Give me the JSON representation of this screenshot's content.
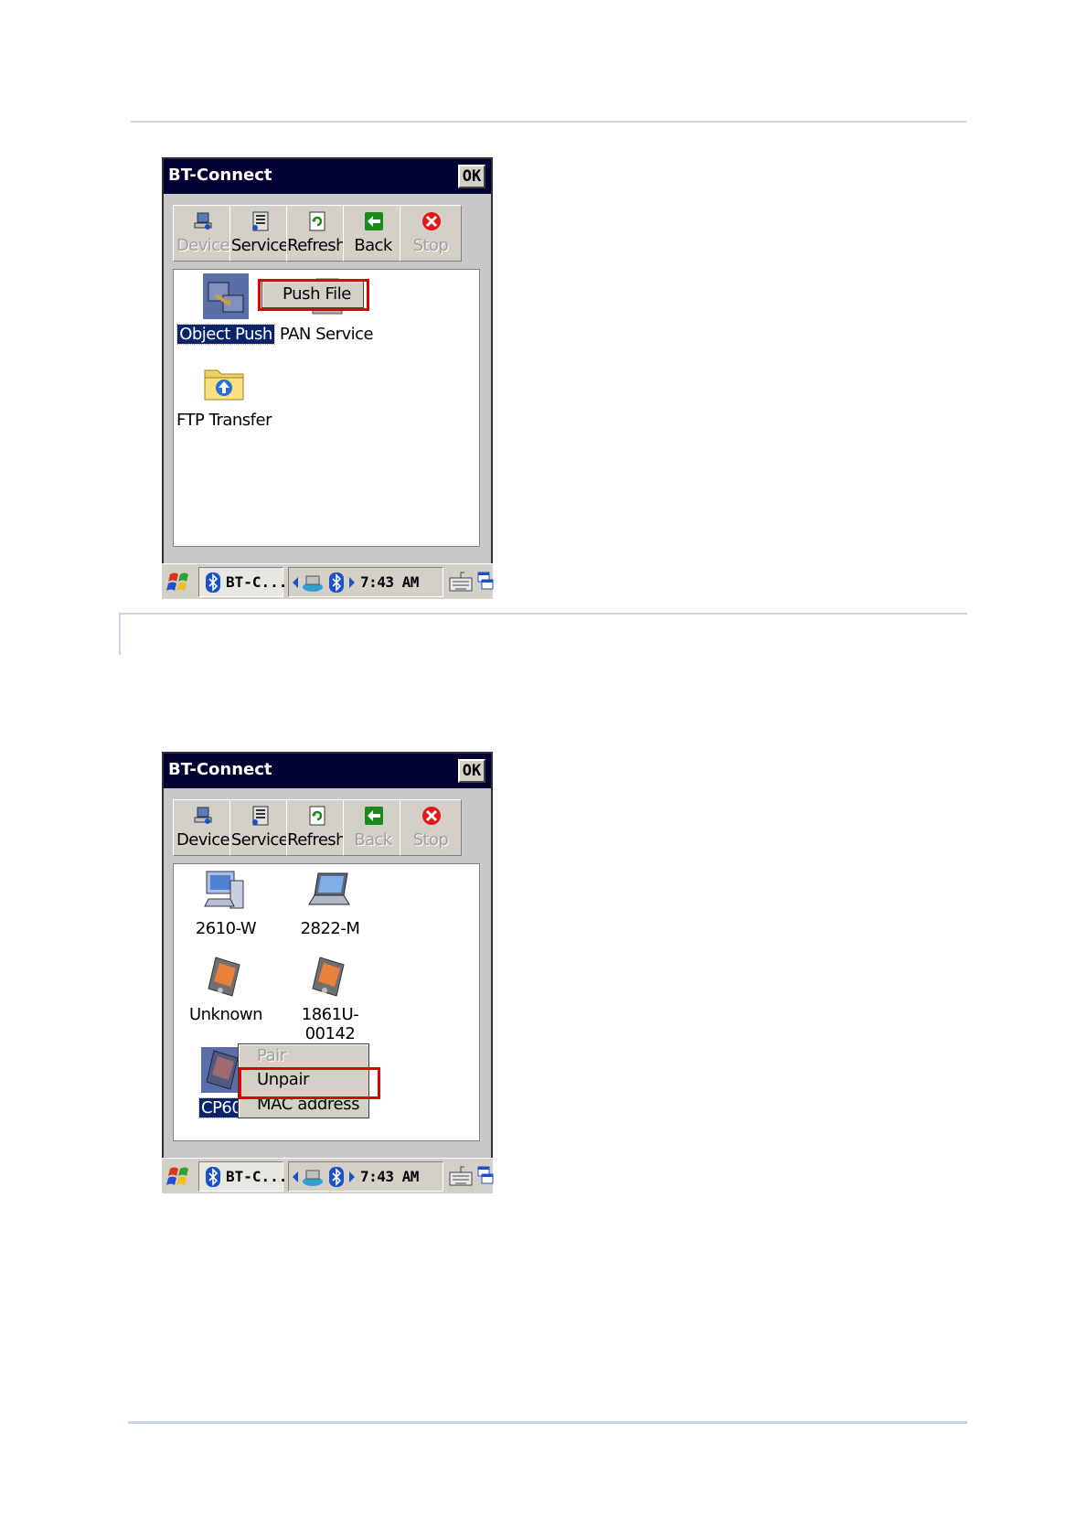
{
  "screens": [
    {
      "app_title": "BT-Connect",
      "ok_label": "OK",
      "toolbar": [
        {
          "label": "Device",
          "icon": "device-icon",
          "enabled": false
        },
        {
          "label": "Service",
          "icon": "service-icon",
          "enabled": true
        },
        {
          "label": "Refresh",
          "icon": "refresh-icon",
          "enabled": true
        },
        {
          "label": "Back",
          "icon": "back-arrow-icon",
          "enabled": true
        },
        {
          "label": "Stop",
          "icon": "stop-icon",
          "enabled": false
        }
      ],
      "items": [
        {
          "label": "Object Push",
          "icon": "object-push-icon",
          "selected": true
        },
        {
          "label": "PAN Service",
          "icon": "pan-service-icon",
          "selected": false
        },
        {
          "label": "FTP Transfer",
          "icon": "ftp-folder-icon",
          "selected": false
        }
      ],
      "context_menu": [
        {
          "label": "Push File",
          "enabled": true,
          "highlighted": true
        }
      ],
      "taskbar": {
        "task_label": "BT-C...",
        "clock": "7:43 AM"
      }
    },
    {
      "app_title": "BT-Connect",
      "ok_label": "OK",
      "toolbar": [
        {
          "label": "Device",
          "icon": "device-icon",
          "enabled": true
        },
        {
          "label": "Service",
          "icon": "service-icon",
          "enabled": true
        },
        {
          "label": "Refresh",
          "icon": "refresh-icon",
          "enabled": true
        },
        {
          "label": "Back",
          "icon": "back-arrow-icon",
          "enabled": false
        },
        {
          "label": "Stop",
          "icon": "stop-icon",
          "enabled": false
        }
      ],
      "items": [
        {
          "label": "2610-W",
          "icon": "desktop-computer-icon",
          "selected": false
        },
        {
          "label": "2822-M",
          "icon": "laptop-icon",
          "selected": false
        },
        {
          "label": "Unknown",
          "icon": "pda-icon",
          "selected": false
        },
        {
          "label": "1861U-",
          "label2": "00142",
          "icon": "pda-icon",
          "selected": false
        },
        {
          "label": "CP60",
          "icon": "pda-icon",
          "selected": true
        }
      ],
      "context_menu": [
        {
          "label": "Pair",
          "enabled": false,
          "highlighted": false
        },
        {
          "label": "Unpair",
          "enabled": true,
          "highlighted": true
        },
        {
          "label": "MAC address",
          "enabled": true,
          "highlighted": false
        }
      ],
      "taskbar": {
        "task_label": "BT-C...",
        "clock": "7:43 AM"
      }
    }
  ],
  "colors": {
    "titlebar": "#000033",
    "selection": "#0a246a",
    "highlight_box": "#e00000",
    "chrome": "#d4d0c8"
  }
}
